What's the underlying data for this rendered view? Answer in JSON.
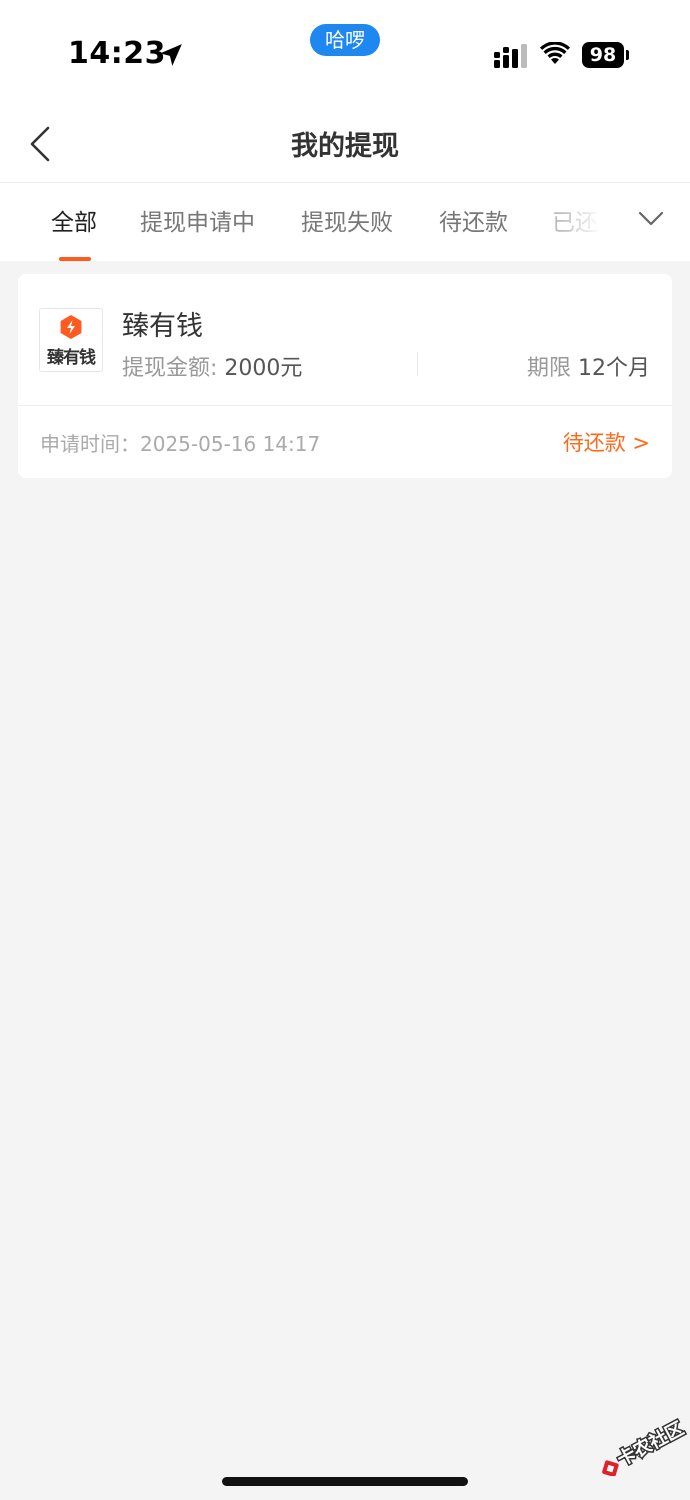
{
  "status_bar": {
    "time": "14:23",
    "pill": "哈啰",
    "battery": "98"
  },
  "nav": {
    "title": "我的提现"
  },
  "tabs": [
    {
      "label": "全部",
      "active": true
    },
    {
      "label": "提现申请中",
      "active": false
    },
    {
      "label": "提现失败",
      "active": false
    },
    {
      "label": "待还款",
      "active": false
    },
    {
      "label": "已还",
      "active": false
    }
  ],
  "records": [
    {
      "logo_text": "臻有钱",
      "product_name": "臻有钱",
      "amount_label": "提现金额: ",
      "amount_value": "2000元",
      "term_label": "期限 ",
      "term_value": "12个月",
      "apply_time": "申请时间：2025-05-16 14:17",
      "status": "待还款 >"
    }
  ],
  "watermark": {
    "text": "卡农社区"
  },
  "colors": {
    "accent": "#ff6a1a",
    "tab_indicator": "#ff5a1f",
    "pill_blue": "#1e88f0",
    "background": "#f4f4f4"
  },
  "icons": [
    "location-arrow-icon",
    "cellular-signal-icon",
    "wifi-icon",
    "battery-icon",
    "back-chevron-icon",
    "chevron-down-icon",
    "brand-logo-icon",
    "watermark-logo-icon"
  ]
}
